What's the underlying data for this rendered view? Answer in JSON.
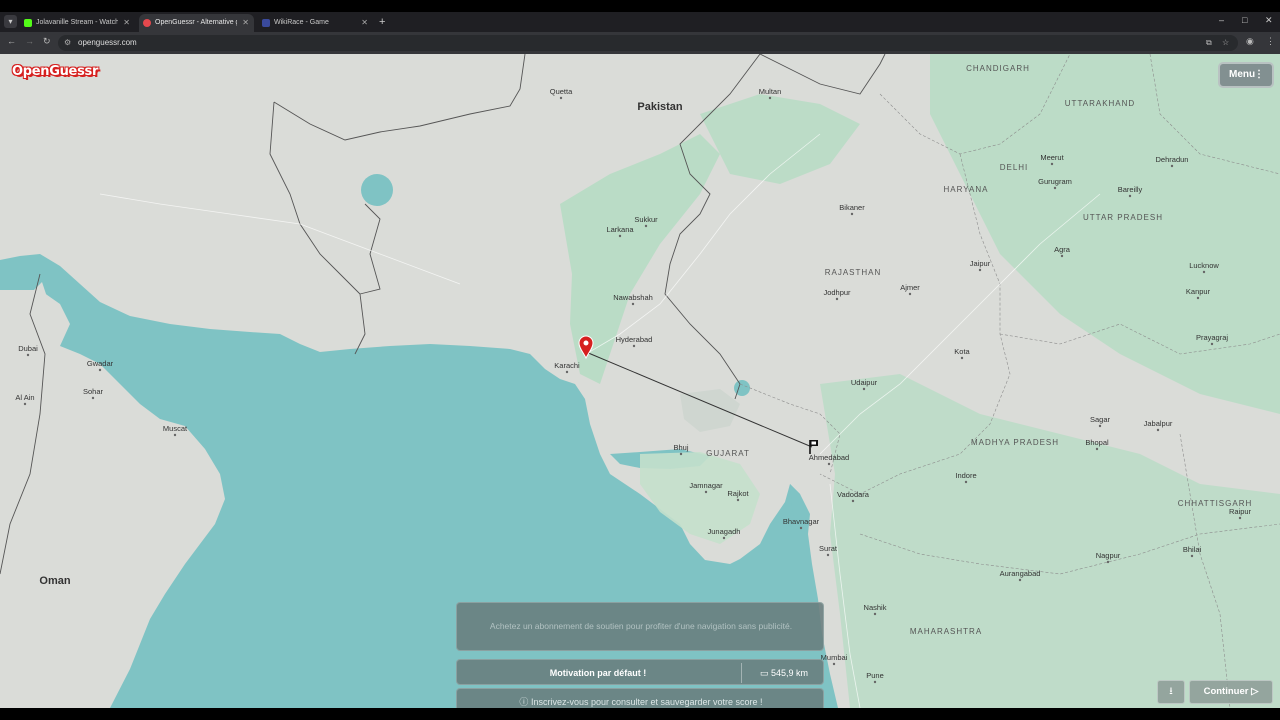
{
  "browser": {
    "tabs": [
      {
        "title": "Jolavanille Stream - Watch Liv",
        "favicon_color": "#53fc18",
        "active": false
      },
      {
        "title": "OpenGuessr - Alternative gratu",
        "favicon_color": "#e5484d",
        "active": true
      },
      {
        "title": "WikiRace - Game",
        "favicon_color": "#3a4a9c",
        "active": false
      }
    ],
    "url": "openguessr.com"
  },
  "app": {
    "logo": "OpenGuessr",
    "menu_label": "Menu",
    "ad_banner": "Achetez un abonnement de soutien pour profiter d'une navigation sans publicité.",
    "motivation": "Motivation par défaut !",
    "distance": "545,9 km",
    "signup": "Inscrivez-vous pour consulter et sauvegarder votre score !",
    "continue_label": "Continuer"
  },
  "map": {
    "countries": [
      "Pakistan",
      "Oman"
    ],
    "regions": [
      "RAJASTHAN",
      "GUJARAT",
      "HARYANA",
      "UTTARAKHAND",
      "UTTAR PRADESH",
      "MADHYA PRADESH",
      "MAHARASHTRA",
      "CHHATTISGARH",
      "CHANDIGARH",
      "DELHI"
    ],
    "cities": [
      "Karachi",
      "Hyderabad",
      "Ahmedabad",
      "Vadodara",
      "Surat",
      "Rajkot",
      "Jamnagar",
      "Bhavnagar",
      "Junagadh",
      "Bhuj",
      "Muscat",
      "Sohar",
      "Dubai",
      "Al Ain",
      "Jaipur",
      "Agra",
      "Lucknow",
      "Kanpur",
      "Gurugram",
      "Indore",
      "Bhopal",
      "Nashik",
      "Pune",
      "Mumbai",
      "Jodhpur",
      "Udaipur",
      "Ajmer",
      "Kota",
      "Bikaner",
      "Sukkur",
      "Larkana",
      "Multan",
      "Nawabshah",
      "Quetta",
      "Gwadar",
      "Nagpur",
      "Aurangabad",
      "Jabalpur",
      "Sagar",
      "Bhilai",
      "Raipur",
      "Prayagraj",
      "Dehradun",
      "Meerut",
      "Bareilly"
    ],
    "guess_marker": "red-pin",
    "answer_marker": "flag"
  },
  "colors": {
    "sea": "#7fc3c4",
    "land": "#dadcd8",
    "forest": "#b6dcc4",
    "border": "#555555",
    "accent_red": "#d6201f"
  }
}
